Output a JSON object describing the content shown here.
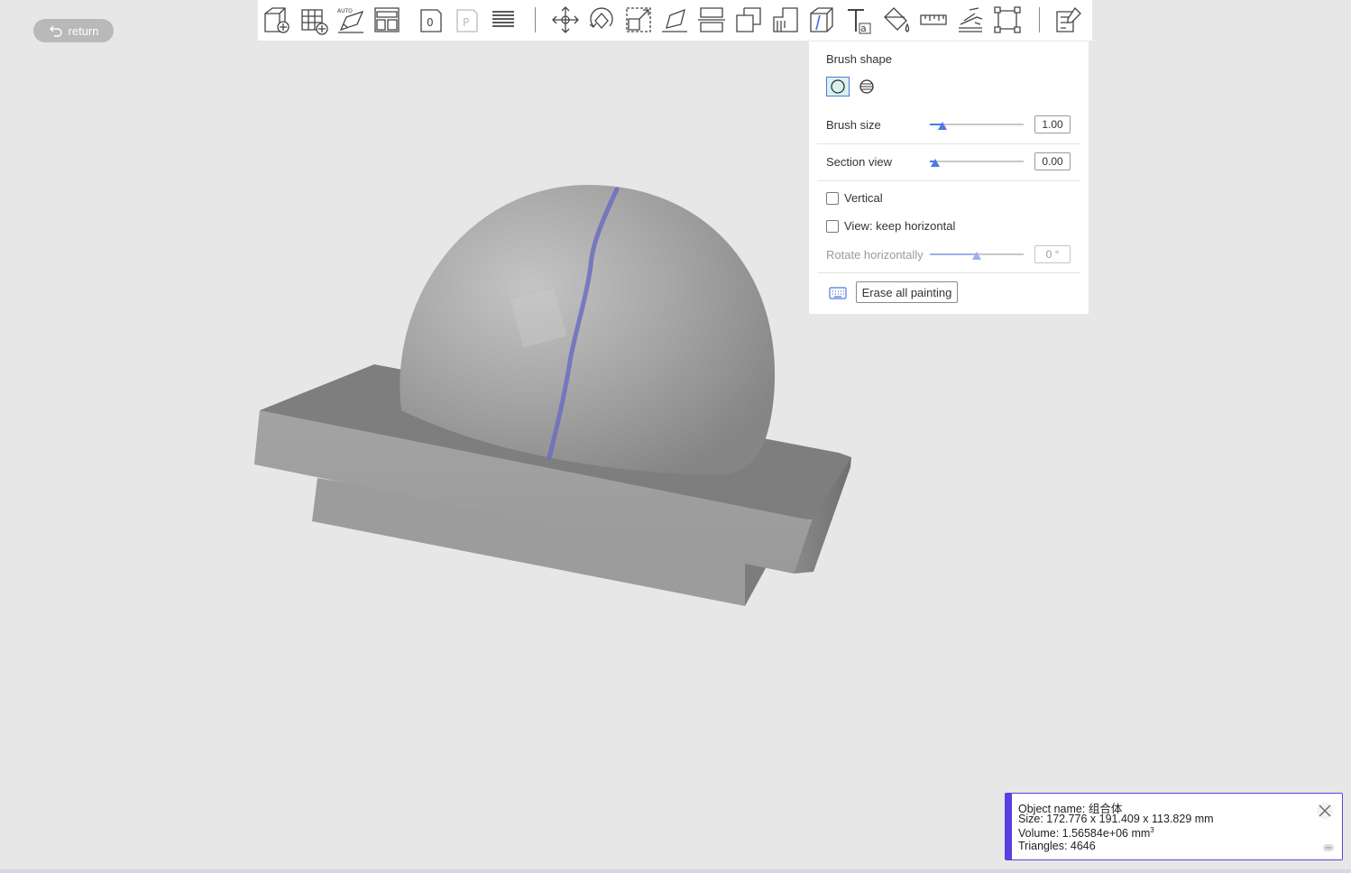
{
  "return_button": {
    "label": "return",
    "icon": "undo-arrow-icon"
  },
  "toolbar": {
    "icons": [
      "add-model-icon",
      "add-grid-icon",
      "auto-layout-icon",
      "arrange-icon",
      "plate-icon",
      "plate-p-icon",
      "layers-icon",
      "move-icon",
      "rotate-icon",
      "scale-icon",
      "lay-flat-icon",
      "cut-icon",
      "split-parts-icon",
      "support-icon",
      "paint-seam-icon",
      "text-emboss-icon",
      "paint-bucket-icon",
      "measure-icon",
      "variable-layer-icon",
      "bounding-box-icon",
      "settings-panel-icon"
    ]
  },
  "paint_panel": {
    "brush_shape_label": "Brush shape",
    "brush_shapes": [
      "circle-brush-icon",
      "sphere-brush-icon"
    ],
    "brush_size": {
      "label": "Brush size",
      "value": "1.00",
      "fraction": 0.13
    },
    "section_view": {
      "label": "Section view",
      "value": "0.00",
      "fraction": 0.06
    },
    "vertical": {
      "label": "Vertical",
      "checked": false
    },
    "keep_horizontal": {
      "label": "View: keep horizontal",
      "checked": false
    },
    "rotate_horizontally": {
      "label": "Rotate horizontally",
      "value": "0 °",
      "fraction": 0.5
    },
    "erase_all_label": "Erase all painting"
  },
  "object_info": {
    "name": "Object name: 组合体",
    "size": "Size: 172.776 x 191.409 x 113.829 mm",
    "volume": "Volume: 1.56584e+06 mm",
    "volume_unit_sup": "3",
    "triangles": "Triangles: 4646"
  },
  "colors": {
    "accent": "#4f78e0",
    "info_border": "#5b3fe0",
    "seam_paint": "#6a6fbf",
    "model_gray": "#9a9a9a",
    "background": "#e7e7e7"
  }
}
